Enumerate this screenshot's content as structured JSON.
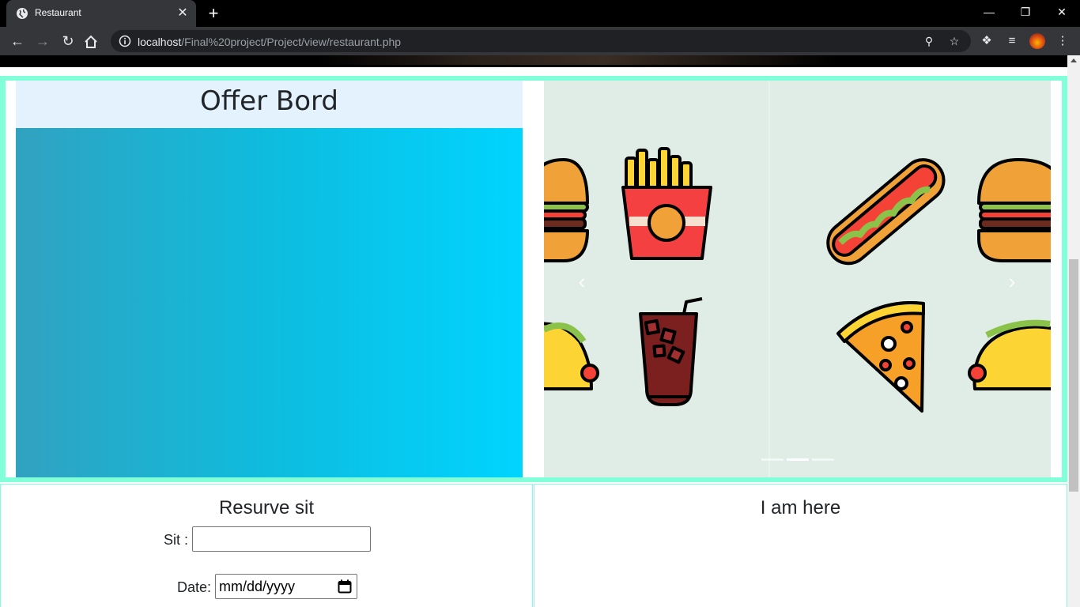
{
  "browser": {
    "tab_title": "Restaurant",
    "tab_close": "✕",
    "new_tab": "+",
    "url_host": "localhost",
    "url_path": "/Final%20project/Project/view/restaurant.php"
  },
  "offer_board": {
    "title": "Offer Bord"
  },
  "carousel": {
    "prev": "‹",
    "next": "›",
    "indicator_count": 3,
    "active_index": 1
  },
  "reservation": {
    "title": "Resurve sit",
    "sit_label": "Sit :",
    "sit_value": "",
    "date_label": "Date:",
    "date_placeholder": "mm/dd/yyyy"
  },
  "location": {
    "title": "I am here"
  },
  "colors": {
    "section_border": "#80ffd8",
    "offer_header_bg": "#e3f2fd",
    "carousel_bg": "#e0ede6"
  }
}
